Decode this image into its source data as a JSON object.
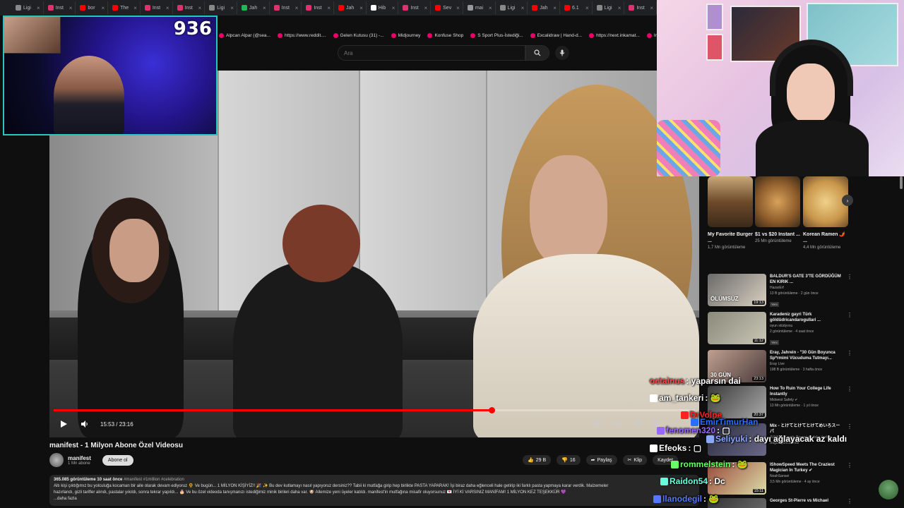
{
  "tabs": [
    {
      "label": "Ligi",
      "color": "#888888"
    },
    {
      "label": "Inst",
      "color": "#e1306c"
    },
    {
      "label": "bor",
      "color": "#ff0000"
    },
    {
      "label": "The",
      "color": "#ff0000"
    },
    {
      "label": "Inst",
      "color": "#e1306c"
    },
    {
      "label": "Inst",
      "color": "#e1306c"
    },
    {
      "label": "Ligi",
      "color": "#888888"
    },
    {
      "label": "Jah",
      "color": "#1db954"
    },
    {
      "label": "Inst",
      "color": "#e1306c"
    },
    {
      "label": "Inst",
      "color": "#e1306c"
    },
    {
      "label": "Jah",
      "color": "#ff0000"
    },
    {
      "label": "Hib",
      "color": "#ffffff"
    },
    {
      "label": "Inst",
      "color": "#e1306c"
    },
    {
      "label": "Sev",
      "color": "#ff0000"
    },
    {
      "label": "mai",
      "color": "#999999"
    },
    {
      "label": "Ligi",
      "color": "#888888"
    },
    {
      "label": "Jah",
      "color": "#ff0000"
    },
    {
      "label": "6.1",
      "color": "#ff0000"
    },
    {
      "label": "Ligi",
      "color": "#888888"
    },
    {
      "label": "Inst",
      "color": "#e1306c"
    }
  ],
  "bookmarks": [
    "Alpcan Alpar (@sea...",
    "https://www.reddit....",
    "Gelen Kutusu (31) -...",
    "Midjourney",
    "Konfuse Shop",
    "S Sport Plus-İstediği...",
    "Excalidraw | Hand-d...",
    "https://next.inkamat...",
    "Inbox - Zoho"
  ],
  "search": {
    "placeholder": "Ara"
  },
  "webcam_left": {
    "counter": "936"
  },
  "player": {
    "time": "15:53 / 23:16",
    "progress_fraction": 0.6826
  },
  "video": {
    "title": "manifest - 1 Milyon Abone Özel Videosu",
    "channel": "manifest",
    "subscribers": "1 Mn abone",
    "subscribe_label": "Abone ol",
    "likes": "29 B",
    "dislikes": "16",
    "share_label": "Paylaş",
    "clip_label": "Klip",
    "save_label": "Kaydet"
  },
  "description": {
    "meta": "365.085 görüntüleme  10 saat önce",
    "tags": "#manifest #1million #celebration",
    "line1": "Altı kişi çıktığımız bu yolculuğa kocaman bir aile olarak devam ediyoruz 🌻 Ve bugün... 1 MİLYON KİŞİYİZ!! 🎉 ✨ Bu dev kutlamayı nasıl yapıyoruz dersiniz?? Tabii ki mutfağa girip hep birlikte PASTA YAPARAK! İşi biraz daha eğlenceli hale getirip iki farklı pasta yapmaya karar verdik. Malzemeler",
    "line2": "hazırlandı, gizli tarifler alındı, pastalar yıkıldı, sonra tekrar yapıldı... 🎂 Ve bu özel videoda tanışmanızı istediğimiz minik birileri daha var. 🐶 Allemize yeni üyeler katıldı. manifest'in mutfağına misafir oluyorsunuz 💌 İYİ Kİ VARSINIZ MANİFAM! 1 MİLYON KEZ TEŞEKKÜR 💜",
    "more": "...daha fazla"
  },
  "shorts": [
    {
      "title": "My Favorite Burger ...",
      "views": "1,7 Mn görüntüleme"
    },
    {
      "title": "$1 vs $20 Instant ...",
      "views": "25 Mn görüntüleme"
    },
    {
      "title": "Korean Ramen 🌶️ ...",
      "views": "4,4 Mn görüntüleme"
    }
  ],
  "recommendations": [
    {
      "title": "BALDUR'S GATE 3'TE GÖRDÜĞÜM EN KIRIK ...",
      "channel": "HazarErf",
      "views": "13 B görüntüleme · 2 gün önce",
      "badge": "Yeni",
      "duration": "19:13",
      "thumb_text": "ÖLÜMSÜZ"
    },
    {
      "title": "Karadeniz gayri Türk göldüdricandaroguIlari ...",
      "channel": "oyun stüdyosu",
      "views": "2 görüntüleme · 4 saat önce",
      "badge": "Yeni",
      "duration": "11:12",
      "thumb_text": ""
    },
    {
      "title": "Eray, Jahrein - \"30 Gün Boyunca Sp*rmimi Vücuduma Tutmayı...",
      "channel": "Eray Live",
      "views": "198 B görüntüleme · 3 hafta önce",
      "badge": "",
      "duration": "23:13",
      "thumb_text": "30 GÜN"
    },
    {
      "title": "How To Ruin Your College Life Instantly",
      "channel": "Midwest Safety ✔",
      "views": "13 Mn görüntüleme · 1 yıl önce",
      "badge": "",
      "duration": "20:37",
      "thumb_text": ""
    },
    {
      "title": "Mix - とけてとけてとけてめいろスーパ",
      "channel": "JUNKIE, Kavaii, Baggaj ve daha fazlası",
      "views": "Bugün güncellendi",
      "badge": "",
      "duration": "",
      "thumb_text": ""
    },
    {
      "title": "IShowSpeed Meets The Craziest Magician In Turkey ✔",
      "channel": "NoahSansei",
      "views": "3,5 Mn görüntüleme · 4 ay önce",
      "badge": "",
      "duration": "15:11",
      "thumb_text": ""
    },
    {
      "title": "Georges St-Pierre vs Michael",
      "channel": "",
      "views": "",
      "badge": "",
      "duration": "",
      "thumb_text": ""
    }
  ],
  "chat": [
    {
      "user": "octainus",
      "text": ": yaparsın dai",
      "color": "#ff4444"
    },
    {
      "user": "am_tankeri",
      "text": ": 🐸",
      "color": "#ffffff"
    },
    {
      "user": "DrVolpe",
      "text": "",
      "color": "#ff2222"
    },
    {
      "user": "EmirTimurHan",
      "text": "",
      "color": "#2a6fff"
    },
    {
      "user": "fenomen320",
      "text": ": ▢",
      "color": "#9966ff"
    },
    {
      "user": "Seliyuki",
      "text": ": dayı ağlayacak az kaldı",
      "color": "#8aa8ff"
    },
    {
      "user": "Efeoks",
      "text": ": ▢",
      "color": "#ffffff"
    },
    {
      "user": "rommelstein",
      "text": ": 🐸",
      "color": "#66ff66"
    },
    {
      "user": "Raidon54",
      "text": ": Dc",
      "color": "#66ffdd"
    },
    {
      "user": "llanodegil",
      "text": ": 🐸",
      "color": "#5577ff"
    }
  ],
  "colors": {
    "accent": "#ff0000",
    "background": "#0f0f0f",
    "webcam_border": "#27c6c6"
  }
}
